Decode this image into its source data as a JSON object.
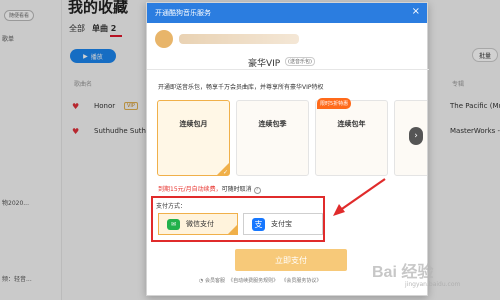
{
  "sidebar": {
    "badge": "随便看看",
    "items": [
      "歌单",
      "物2020...",
      "频：轻音..."
    ]
  },
  "main": {
    "page_title": "我的收藏",
    "tabs": [
      {
        "label": "全部"
      },
      {
        "label": "单曲",
        "count": "2"
      }
    ],
    "play_label": "播放",
    "share_label": "批量",
    "columns": {
      "title": "歌曲名",
      "album": "专辑"
    },
    "rows": [
      {
        "title": "Honor",
        "tag": "VIP",
        "album": "The Pacific (Music"
      },
      {
        "title": "Suthudhe Suth",
        "tag": "",
        "album": "MasterWorks - Kai"
      }
    ]
  },
  "modal": {
    "title": "开通酷狗音乐服务",
    "vip_tab": {
      "label": "豪华VIP",
      "sub": "(送音乐包)"
    },
    "description": "开通即送音乐包，畅享千万会员曲库，并尊享所有豪华VIP特权",
    "plans": [
      {
        "label": "连续包月",
        "selected": true
      },
      {
        "label": "连续包季",
        "selected": false
      },
      {
        "label": "连续包年",
        "selected": false
      },
      {
        "label": "1",
        "selected": false
      }
    ],
    "plan_badge": "限时5折特惠",
    "renew_note": {
      "highlight": "到期15元/月自动续费，",
      "rest": "可随时取消"
    },
    "payment": {
      "label": "支付方式：",
      "options": [
        {
          "label": "微信支付",
          "icon": "wechat-icon",
          "selected": true
        },
        {
          "label": "支付宝",
          "icon": "alipay-icon",
          "selected": false
        }
      ]
    },
    "pay_button": "立即支付",
    "footer": [
      "会员客服",
      "《自动续费服务规则》",
      "《会员服务协议》"
    ]
  },
  "watermark": {
    "text": "Bai 经验",
    "sub": "jingyan.baidu.com"
  }
}
